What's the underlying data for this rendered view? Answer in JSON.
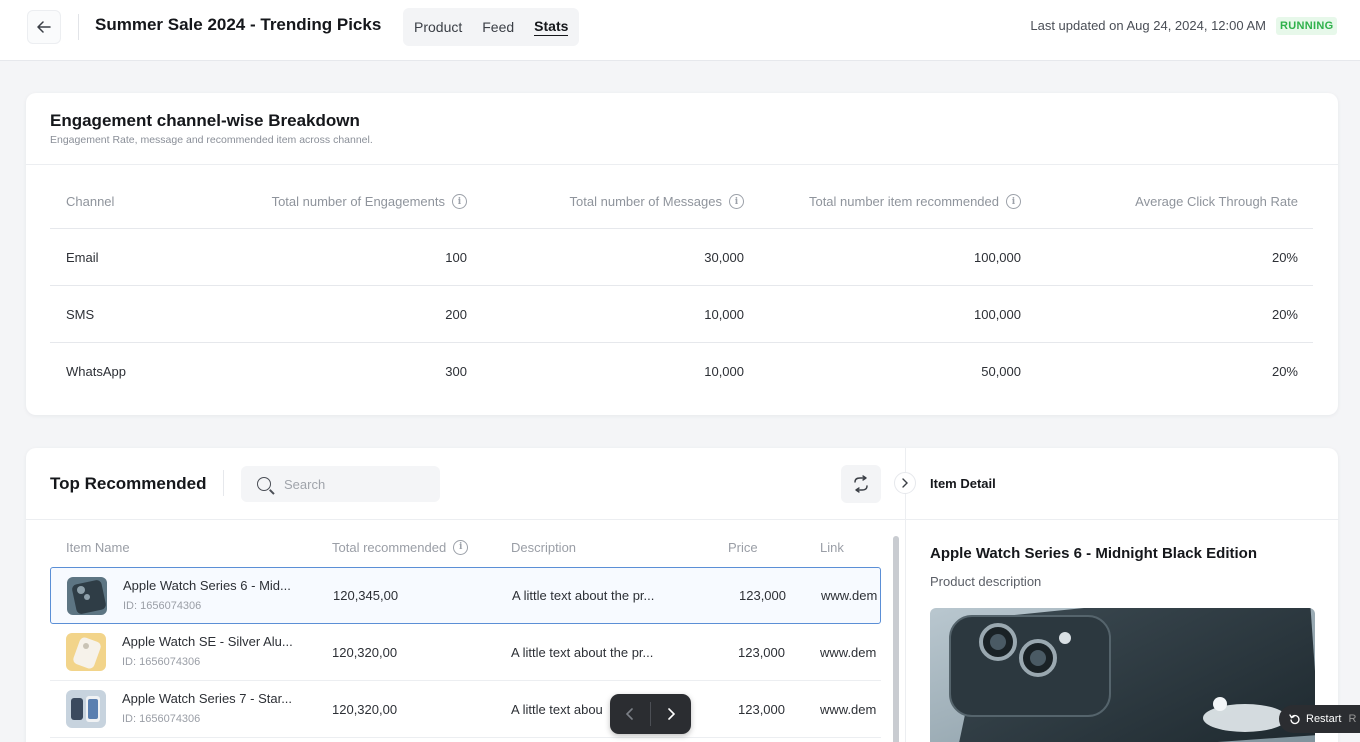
{
  "header": {
    "back_icon": "arrow-left-icon",
    "title": "Summer Sale 2024 - Trending Picks",
    "tabs": [
      {
        "label": "Product",
        "active": false
      },
      {
        "label": "Feed",
        "active": false
      },
      {
        "label": "Stats",
        "active": true
      }
    ],
    "last_updated": "Last updated on Aug 24, 2024, 12:00 AM",
    "status": "RUNNING",
    "status_color": "#2fb14b"
  },
  "engagement": {
    "title": "Engagement channel-wise Breakdown",
    "subtitle": "Engagement Rate, message and recommended item across channel.",
    "columns": [
      "Channel",
      "Total number of Engagements",
      "Total number of Messages",
      "Total number item recommended",
      "Average Click Through Rate"
    ],
    "rows": [
      {
        "channel": "Email",
        "engagements": "100",
        "messages": "30,000",
        "recommended": "100,000",
        "ctr": "20%"
      },
      {
        "channel": "SMS",
        "engagements": "200",
        "messages": "10,000",
        "recommended": "100,000",
        "ctr": "20%"
      },
      {
        "channel": "WhatsApp",
        "engagements": "300",
        "messages": "10,000",
        "recommended": "50,000",
        "ctr": "20%"
      }
    ]
  },
  "top_recommended": {
    "title": "Top Recommended",
    "search_placeholder": "Search",
    "columns": [
      "Item Name",
      "Total recommended",
      "Description",
      "Price",
      "Link"
    ],
    "items": [
      {
        "name": "Apple Watch Series 6 - Mid...",
        "id": "ID: 1656074306",
        "total": "120,345,00",
        "description": "A little text about the pr...",
        "price": "123,000",
        "link": "www.dem",
        "selected": true
      },
      {
        "name": "Apple Watch SE - Silver Alu...",
        "id": "ID: 1656074306",
        "total": "120,320,00",
        "description": "A little text about the pr...",
        "price": "123,000",
        "link": "www.dem",
        "selected": false
      },
      {
        "name": "Apple Watch Series 7 - Star...",
        "id": "ID: 1656074306",
        "total": "120,320,00",
        "description": "A little text abou",
        "price": "123,000",
        "link": "www.dem",
        "selected": false
      }
    ]
  },
  "item_detail": {
    "header": "Item Detail",
    "name": "Apple Watch Series 6 - Midnight Black Edition",
    "description": "Product description"
  },
  "overlay": {
    "restart_label": "Restart",
    "restart_trailing": "R"
  }
}
